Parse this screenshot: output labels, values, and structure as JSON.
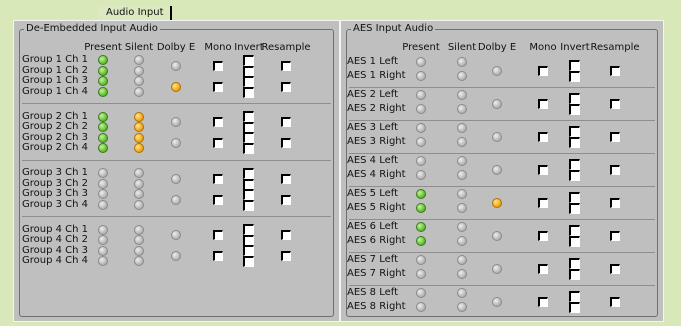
{
  "tab": {
    "label": "Audio Input"
  },
  "headers": [
    "Present",
    "Silent",
    "Dolby E",
    "Mono",
    "Invert",
    "Resample"
  ],
  "panels": [
    {
      "title": "De-Embedded Input Audio",
      "blocks": [
        {
          "labels": [
            "Group 1 Ch 1",
            "Group 1 Ch 2",
            "Group 1 Ch 3",
            "Group 1 Ch 4"
          ],
          "present": [
            "green",
            "green",
            "green",
            "green"
          ],
          "silent": [
            "grey",
            "grey",
            "grey",
            "grey"
          ],
          "dolby": [
            "grey",
            "orange"
          ]
        },
        {
          "labels": [
            "Group 2 Ch 1",
            "Group 2 Ch 2",
            "Group 2 Ch 3",
            "Group 2 Ch 4"
          ],
          "present": [
            "green",
            "green",
            "green",
            "green"
          ],
          "silent": [
            "orange",
            "orange",
            "orange",
            "orange"
          ],
          "dolby": [
            "grey",
            "grey"
          ]
        },
        {
          "labels": [
            "Group 3 Ch 1",
            "Group 3 Ch 2",
            "Group 3 Ch 3",
            "Group 3 Ch 4"
          ],
          "present": [
            "grey",
            "grey",
            "grey",
            "grey"
          ],
          "silent": [
            "grey",
            "grey",
            "grey",
            "grey"
          ],
          "dolby": [
            "grey",
            "grey"
          ]
        },
        {
          "labels": [
            "Group 4 Ch 1",
            "Group 4 Ch 2",
            "Group 4 Ch 3",
            "Group 4 Ch 4"
          ],
          "present": [
            "grey",
            "grey",
            "grey",
            "grey"
          ],
          "silent": [
            "grey",
            "grey",
            "grey",
            "grey"
          ],
          "dolby": [
            "grey",
            "grey"
          ]
        }
      ]
    },
    {
      "title": "AES Input Audio",
      "blocks": [
        {
          "labels": [
            "AES 1 Left",
            "AES 1 Right"
          ],
          "present": [
            "grey",
            "grey"
          ],
          "silent": [
            "grey",
            "grey"
          ],
          "dolby": [
            "grey"
          ]
        },
        {
          "labels": [
            "AES 2 Left",
            "AES 2 Right"
          ],
          "present": [
            "grey",
            "grey"
          ],
          "silent": [
            "grey",
            "grey"
          ],
          "dolby": [
            "grey"
          ]
        },
        {
          "labels": [
            "AES 3 Left",
            "AES 3 Right"
          ],
          "present": [
            "grey",
            "grey"
          ],
          "silent": [
            "grey",
            "grey"
          ],
          "dolby": [
            "grey"
          ]
        },
        {
          "labels": [
            "AES 4 Left",
            "AES 4 Right"
          ],
          "present": [
            "grey",
            "grey"
          ],
          "silent": [
            "grey",
            "grey"
          ],
          "dolby": [
            "grey"
          ]
        },
        {
          "labels": [
            "AES 5 Left",
            "AES 5 Right"
          ],
          "present": [
            "green",
            "green"
          ],
          "silent": [
            "grey",
            "grey"
          ],
          "dolby": [
            "orange"
          ]
        },
        {
          "labels": [
            "AES 6 Left",
            "AES 6 Right"
          ],
          "present": [
            "green",
            "green"
          ],
          "silent": [
            "grey",
            "grey"
          ],
          "dolby": [
            "grey"
          ]
        },
        {
          "labels": [
            "AES 7 Left",
            "AES 7 Right"
          ],
          "present": [
            "grey",
            "grey"
          ],
          "silent": [
            "grey",
            "grey"
          ],
          "dolby": [
            "grey"
          ]
        },
        {
          "labels": [
            "AES 8 Left",
            "AES 8 Right"
          ],
          "present": [
            "grey",
            "grey"
          ],
          "silent": [
            "grey",
            "grey"
          ],
          "dolby": [
            "grey"
          ]
        }
      ]
    }
  ],
  "colors": {
    "green": "#6cc83a",
    "orange": "#f4b020",
    "grey": "#bdbdbd"
  }
}
